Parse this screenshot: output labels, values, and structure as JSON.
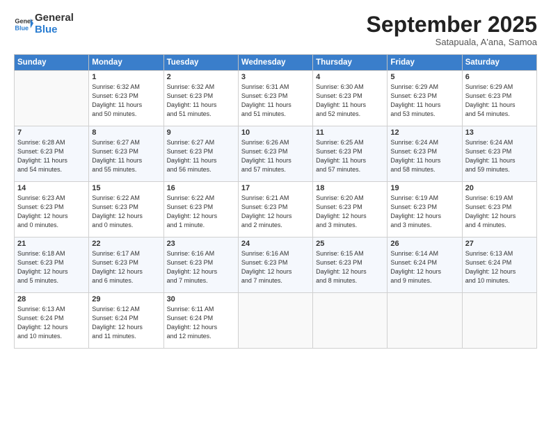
{
  "logo": {
    "general": "General",
    "blue": "Blue"
  },
  "header": {
    "month": "September 2025",
    "location": "Satapuala, A'ana, Samoa"
  },
  "days_of_week": [
    "Sunday",
    "Monday",
    "Tuesday",
    "Wednesday",
    "Thursday",
    "Friday",
    "Saturday"
  ],
  "weeks": [
    [
      {
        "day": "",
        "content": ""
      },
      {
        "day": "1",
        "content": "Sunrise: 6:32 AM\nSunset: 6:23 PM\nDaylight: 11 hours\nand 50 minutes."
      },
      {
        "day": "2",
        "content": "Sunrise: 6:32 AM\nSunset: 6:23 PM\nDaylight: 11 hours\nand 51 minutes."
      },
      {
        "day": "3",
        "content": "Sunrise: 6:31 AM\nSunset: 6:23 PM\nDaylight: 11 hours\nand 51 minutes."
      },
      {
        "day": "4",
        "content": "Sunrise: 6:30 AM\nSunset: 6:23 PM\nDaylight: 11 hours\nand 52 minutes."
      },
      {
        "day": "5",
        "content": "Sunrise: 6:29 AM\nSunset: 6:23 PM\nDaylight: 11 hours\nand 53 minutes."
      },
      {
        "day": "6",
        "content": "Sunrise: 6:29 AM\nSunset: 6:23 PM\nDaylight: 11 hours\nand 54 minutes."
      }
    ],
    [
      {
        "day": "7",
        "content": "Sunrise: 6:28 AM\nSunset: 6:23 PM\nDaylight: 11 hours\nand 54 minutes."
      },
      {
        "day": "8",
        "content": "Sunrise: 6:27 AM\nSunset: 6:23 PM\nDaylight: 11 hours\nand 55 minutes."
      },
      {
        "day": "9",
        "content": "Sunrise: 6:27 AM\nSunset: 6:23 PM\nDaylight: 11 hours\nand 56 minutes."
      },
      {
        "day": "10",
        "content": "Sunrise: 6:26 AM\nSunset: 6:23 PM\nDaylight: 11 hours\nand 57 minutes."
      },
      {
        "day": "11",
        "content": "Sunrise: 6:25 AM\nSunset: 6:23 PM\nDaylight: 11 hours\nand 57 minutes."
      },
      {
        "day": "12",
        "content": "Sunrise: 6:24 AM\nSunset: 6:23 PM\nDaylight: 11 hours\nand 58 minutes."
      },
      {
        "day": "13",
        "content": "Sunrise: 6:24 AM\nSunset: 6:23 PM\nDaylight: 11 hours\nand 59 minutes."
      }
    ],
    [
      {
        "day": "14",
        "content": "Sunrise: 6:23 AM\nSunset: 6:23 PM\nDaylight: 12 hours\nand 0 minutes."
      },
      {
        "day": "15",
        "content": "Sunrise: 6:22 AM\nSunset: 6:23 PM\nDaylight: 12 hours\nand 0 minutes."
      },
      {
        "day": "16",
        "content": "Sunrise: 6:22 AM\nSunset: 6:23 PM\nDaylight: 12 hours\nand 1 minute."
      },
      {
        "day": "17",
        "content": "Sunrise: 6:21 AM\nSunset: 6:23 PM\nDaylight: 12 hours\nand 2 minutes."
      },
      {
        "day": "18",
        "content": "Sunrise: 6:20 AM\nSunset: 6:23 PM\nDaylight: 12 hours\nand 3 minutes."
      },
      {
        "day": "19",
        "content": "Sunrise: 6:19 AM\nSunset: 6:23 PM\nDaylight: 12 hours\nand 3 minutes."
      },
      {
        "day": "20",
        "content": "Sunrise: 6:19 AM\nSunset: 6:23 PM\nDaylight: 12 hours\nand 4 minutes."
      }
    ],
    [
      {
        "day": "21",
        "content": "Sunrise: 6:18 AM\nSunset: 6:23 PM\nDaylight: 12 hours\nand 5 minutes."
      },
      {
        "day": "22",
        "content": "Sunrise: 6:17 AM\nSunset: 6:23 PM\nDaylight: 12 hours\nand 6 minutes."
      },
      {
        "day": "23",
        "content": "Sunrise: 6:16 AM\nSunset: 6:23 PM\nDaylight: 12 hours\nand 7 minutes."
      },
      {
        "day": "24",
        "content": "Sunrise: 6:16 AM\nSunset: 6:23 PM\nDaylight: 12 hours\nand 7 minutes."
      },
      {
        "day": "25",
        "content": "Sunrise: 6:15 AM\nSunset: 6:23 PM\nDaylight: 12 hours\nand 8 minutes."
      },
      {
        "day": "26",
        "content": "Sunrise: 6:14 AM\nSunset: 6:24 PM\nDaylight: 12 hours\nand 9 minutes."
      },
      {
        "day": "27",
        "content": "Sunrise: 6:13 AM\nSunset: 6:24 PM\nDaylight: 12 hours\nand 10 minutes."
      }
    ],
    [
      {
        "day": "28",
        "content": "Sunrise: 6:13 AM\nSunset: 6:24 PM\nDaylight: 12 hours\nand 10 minutes."
      },
      {
        "day": "29",
        "content": "Sunrise: 6:12 AM\nSunset: 6:24 PM\nDaylight: 12 hours\nand 11 minutes."
      },
      {
        "day": "30",
        "content": "Sunrise: 6:11 AM\nSunset: 6:24 PM\nDaylight: 12 hours\nand 12 minutes."
      },
      {
        "day": "",
        "content": ""
      },
      {
        "day": "",
        "content": ""
      },
      {
        "day": "",
        "content": ""
      },
      {
        "day": "",
        "content": ""
      }
    ]
  ]
}
